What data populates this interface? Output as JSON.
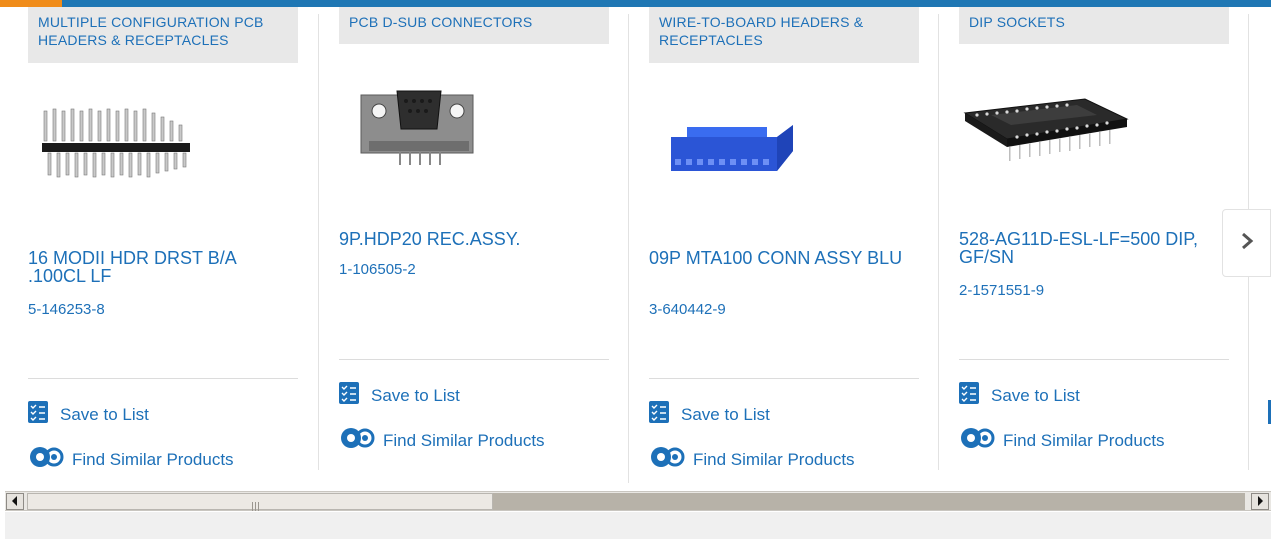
{
  "brand": {
    "accent": "#f08c1a",
    "bar": "#1f77b4",
    "link": "#1d70b8"
  },
  "cards": [
    {
      "category": "MULTIPLE CONFIGURATION PCB HEADERS & RECEPTACLES",
      "title": "16 MODII HDR DRST B/A .100CL LF",
      "part_number": "5-146253-8",
      "image": "pin-header-image",
      "save_label": "Save to List",
      "similar_label": "Find Similar Products"
    },
    {
      "category": "PCB D-SUB CONNECTORS",
      "title": "9P.HDP20 REC.ASSY.",
      "part_number": "1-106505-2",
      "image": "dsub-connector-image",
      "save_label": "Save to List",
      "similar_label": "Find Similar Products"
    },
    {
      "category": "WIRE-TO-BOARD HEADERS & RECEPTACLES",
      "title": "09P MTA100 CONN ASSY BLU",
      "part_number": "3-640442-9",
      "image": "blue-connector-image",
      "save_label": "Save to List",
      "similar_label": "Find Similar Products"
    },
    {
      "category": "DIP SOCKETS",
      "title": "528-AG11D-ESL-LF=500 DIP, GF/SN",
      "part_number": "2-1571551-9",
      "image": "dip-socket-image",
      "save_label": "Save to List",
      "similar_label": "Find Similar Products"
    }
  ],
  "next_button": {
    "icon": "chevron-right-icon"
  },
  "scrollbar": {
    "left_icon": "arrow-left-icon",
    "right_icon": "arrow-right-icon"
  }
}
